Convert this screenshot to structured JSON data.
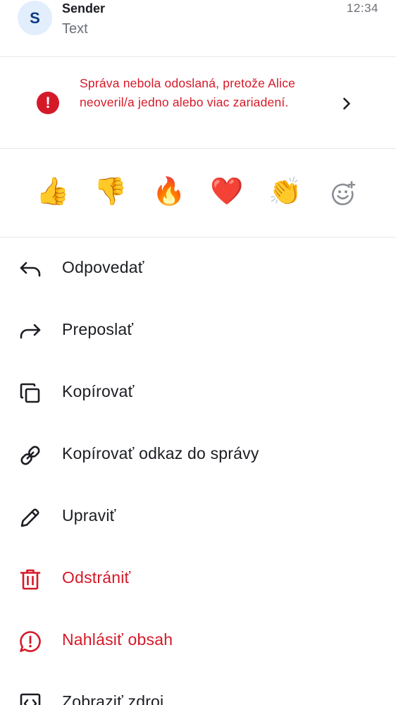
{
  "header": {
    "avatar_initial": "S",
    "sender_name": "Sender",
    "message_text": "Text",
    "timestamp": "12:34"
  },
  "warning": {
    "icon": "error-icon",
    "text": "Správa nebola odoslaná, pretože Alice neoveril/a jedno alebo viac zariadení.",
    "color": "#d51928"
  },
  "reactions": {
    "items": [
      {
        "emoji": "👍",
        "name": "thumbs-up"
      },
      {
        "emoji": "👎",
        "name": "thumbs-down"
      },
      {
        "emoji": "🔥",
        "name": "fire"
      },
      {
        "emoji": "❤️",
        "name": "red-heart"
      },
      {
        "emoji": "👏",
        "name": "clapping-hands"
      }
    ],
    "add_icon": "add-reaction-icon"
  },
  "menu": {
    "items": [
      {
        "label": "Odpovedať",
        "icon": "reply-icon",
        "critical": false
      },
      {
        "label": "Preposlať",
        "icon": "forward-icon",
        "critical": false
      },
      {
        "label": "Kopírovať",
        "icon": "copy-icon",
        "critical": false
      },
      {
        "label": "Kopírovať odkaz do správy",
        "icon": "link-icon",
        "critical": false
      },
      {
        "label": "Upraviť",
        "icon": "edit-icon",
        "critical": false
      },
      {
        "label": "Odstrániť",
        "icon": "delete-icon",
        "critical": true
      },
      {
        "label": "Nahlásiť obsah",
        "icon": "report-icon",
        "critical": true
      },
      {
        "label": "Zobraziť zdroj",
        "icon": "view-source-icon",
        "critical": false
      }
    ]
  },
  "colors": {
    "critical": "#d51928",
    "primary_text": "#1b1d22",
    "secondary_text": "#6b6f76",
    "avatar_bg": "#e3eefc",
    "avatar_fg": "#0d3a82"
  }
}
